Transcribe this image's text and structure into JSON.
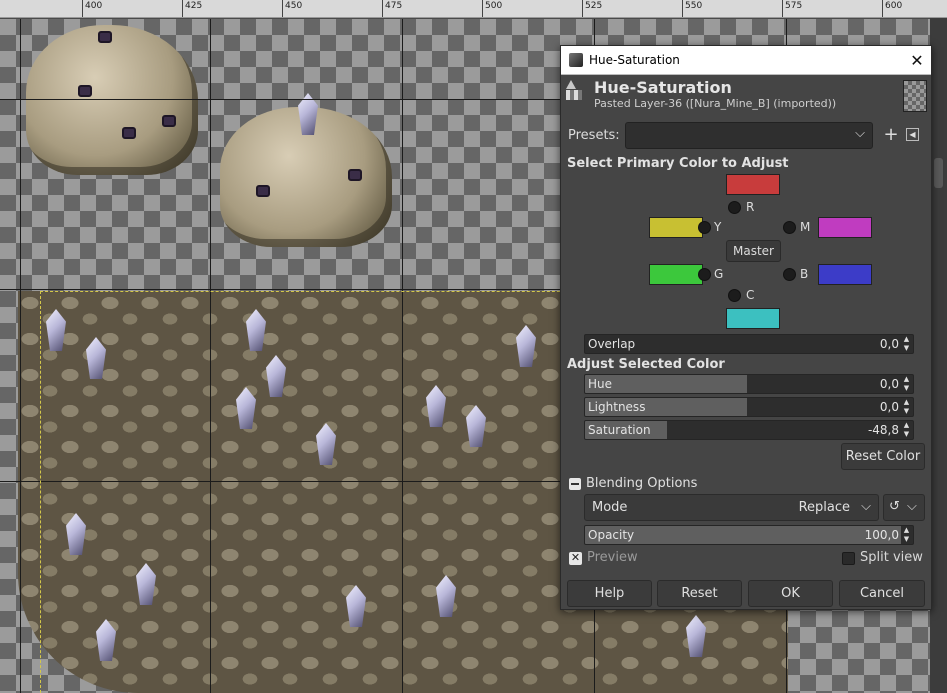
{
  "ruler": {
    "labels": [
      "400",
      "425",
      "450",
      "475",
      "500",
      "525",
      "550",
      "575",
      "600"
    ]
  },
  "dialog": {
    "window_title": "Hue-Saturation",
    "header_title": "Hue-Saturation",
    "header_subtitle": "Pasted Layer-36 ([Nura_Mine_B] (imported))",
    "presets_label": "Presets:",
    "presets_value": "",
    "primary_section_title": "Select Primary Color to Adjust",
    "colors": {
      "R": {
        "label": "R",
        "color": "#c83c3c"
      },
      "Y": {
        "label": "Y",
        "color": "#c8c032"
      },
      "M": {
        "label": "M",
        "color": "#c03cc0"
      },
      "G": {
        "label": "G",
        "color": "#3cc83c"
      },
      "B": {
        "label": "B",
        "color": "#3c3cc8"
      },
      "C": {
        "label": "C",
        "color": "#3cc0c0"
      }
    },
    "master_label": "Master",
    "overlap": {
      "label": "Overlap",
      "value": "0,0"
    },
    "adjust_section_title": "Adjust Selected Color",
    "hue": {
      "label": "Hue",
      "value": "0,0"
    },
    "lightness": {
      "label": "Lightness",
      "value": "0,0"
    },
    "saturation": {
      "label": "Saturation",
      "value": "-48,8"
    },
    "reset_color_label": "Reset Color",
    "blending_label": "Blending Options",
    "mode": {
      "label": "Mode",
      "value": "Replace"
    },
    "opacity": {
      "label": "Opacity",
      "value": "100,0"
    },
    "preview_label": "Preview",
    "split_view_label": "Split view",
    "buttons": {
      "help": "Help",
      "reset": "Reset",
      "ok": "OK",
      "cancel": "Cancel"
    }
  }
}
